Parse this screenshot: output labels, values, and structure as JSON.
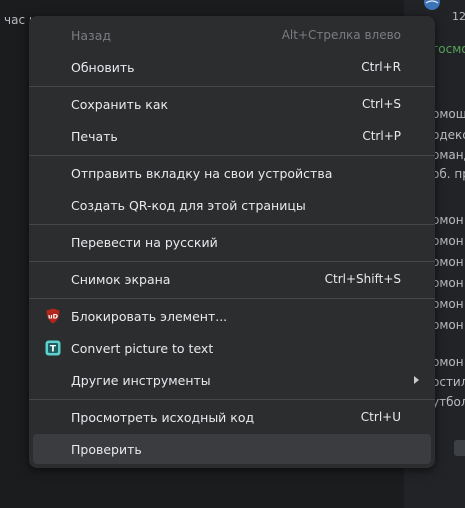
{
  "background": {
    "left_text": "час на",
    "right_top": "12",
    "right_green": "госмо",
    "right_lines": [
      "омощ",
      "одекс",
      "оманд",
      "об. пр"
    ],
    "right_list": [
      "омон",
      "омон",
      "омон",
      "омон",
      "омон",
      "омон",
      "омон",
      "остил",
      "утбол"
    ],
    "accent_green": "#57a55a"
  },
  "menu": {
    "items": [
      {
        "label": "Назад",
        "shortcut": "Alt+Стрелка влево",
        "disabled": true
      },
      {
        "label": "Обновить",
        "shortcut": "Ctrl+R"
      },
      {
        "label": "Сохранить как",
        "shortcut": "Ctrl+S"
      },
      {
        "label": "Печать",
        "shortcut": "Ctrl+P"
      },
      {
        "label": "Отправить вкладку на свои устройства",
        "shortcut": ""
      },
      {
        "label": "Создать QR-код для этой страницы",
        "shortcut": ""
      },
      {
        "label": "Перевести на русский",
        "shortcut": ""
      },
      {
        "label": "Снимок экрана",
        "shortcut": "Ctrl+Shift+S"
      },
      {
        "label": "Блокировать элемент...",
        "shortcut": "",
        "icon": "ublock-origin-icon",
        "icon_text": "uD"
      },
      {
        "label": "Convert picture to text",
        "shortcut": "",
        "icon": "convert-text-extension-icon",
        "icon_text": "T"
      },
      {
        "label": "Другие инструменты",
        "shortcut": "",
        "submenu": true
      },
      {
        "label": "Просмотреть исходный код",
        "shortcut": "Ctrl+U"
      },
      {
        "label": "Проверить",
        "shortcut": "",
        "hovered": true
      }
    ]
  },
  "colors": {
    "menu_bg": "#2c2d2f",
    "hover_bg": "#3b3c3f",
    "ublock_red": "#b3261e",
    "extension_teal": "#5ad1c9"
  }
}
